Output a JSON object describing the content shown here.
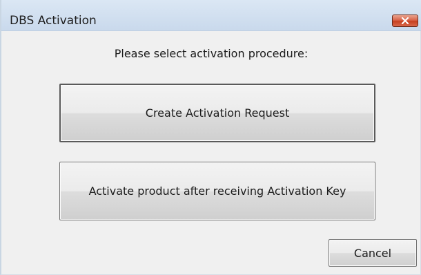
{
  "window": {
    "title": "DBS Activation",
    "close_icon": "close-icon",
    "close_color": "#c7401f"
  },
  "dialog": {
    "prompt": "Please select activation procedure:",
    "create_request_label": "Create Activation Request",
    "activate_product_label": "Activate product after receiving Activation Key",
    "cancel_label": "Cancel"
  }
}
